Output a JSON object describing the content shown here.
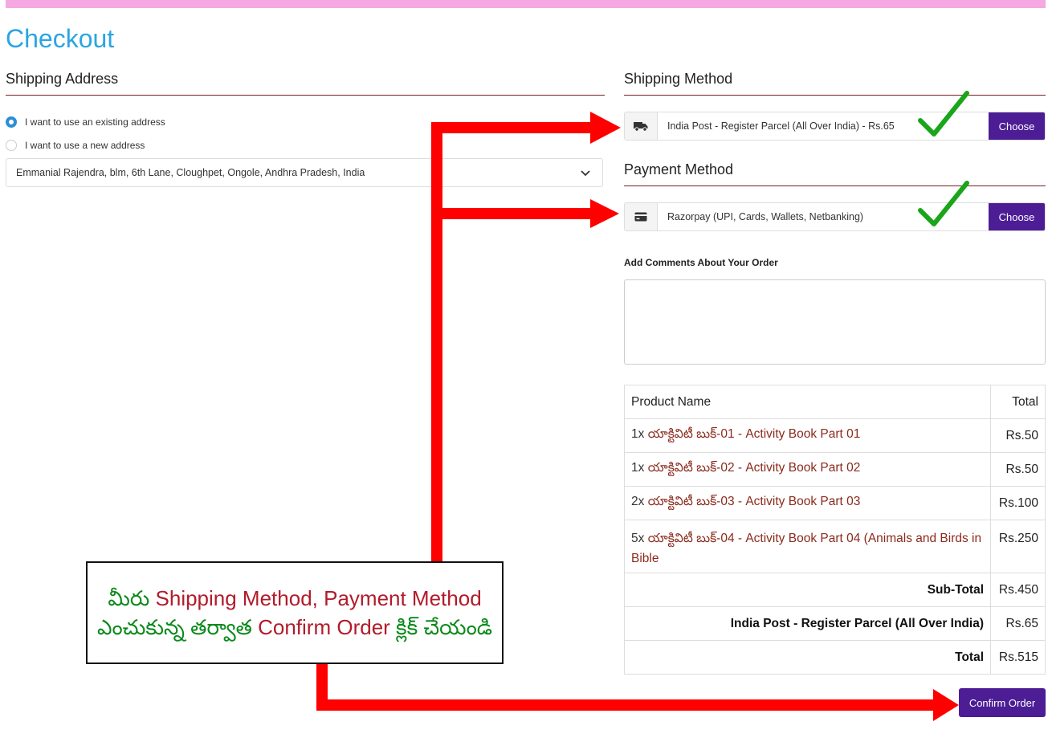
{
  "page": {
    "title": "Checkout"
  },
  "colors": {
    "accent": "#4c1d95",
    "title": "#2ba5e2",
    "annotation_arrow": "#ff0000",
    "check": "#1aa51a",
    "topbar": "#f6a8e2"
  },
  "shipping_address": {
    "title": "Shipping Address",
    "options": [
      {
        "label": "I want to use an existing address",
        "checked": true
      },
      {
        "label": "I want to use a new address",
        "checked": false
      }
    ],
    "selected_address": "Emmanial Rajendra, blm, 6th Lane, Cloughpet, Ongole, Andhra Pradesh, India"
  },
  "shipping_method": {
    "title": "Shipping Method",
    "icon": "truck-icon",
    "value": "India Post - Register Parcel (All Over India) - Rs.65",
    "button": "Choose"
  },
  "payment_method": {
    "title": "Payment Method",
    "icon": "credit-card-icon",
    "value": "Razorpay (UPI, Cards, Wallets, Netbanking)",
    "button": "Choose"
  },
  "comments": {
    "label": "Add Comments About Your Order"
  },
  "order": {
    "headers": {
      "product": "Product Name",
      "total": "Total"
    },
    "items": [
      {
        "qty": "1x",
        "name": "యాక్టివిటీ బుక్-01 - Activity Book Part 01",
        "total": "Rs.50"
      },
      {
        "qty": "1x",
        "name": "యాక్టివిటీ బుక్-02 - Activity Book Part 02",
        "total": "Rs.50"
      },
      {
        "qty": "2x",
        "name": "యాక్టివిటీ బుక్-03 - Activity Book Part 03",
        "total": "Rs.100"
      },
      {
        "qty": "5x",
        "name": "యాక్టివిటీ బుక్-04 - Activity Book Part 04 (Animals and Birds in Bible",
        "total": "Rs.250"
      }
    ],
    "subtotal": {
      "label": "Sub-Total",
      "value": "Rs.450"
    },
    "shipping": {
      "label": "India Post - Register Parcel (All Over India)",
      "value": "Rs.65"
    },
    "total": {
      "label": "Total",
      "value": "Rs.515"
    }
  },
  "confirm_button": "Confirm Order",
  "annotation": {
    "line1_te": "మీరు",
    "line1_en": "Shipping Method, Payment Method",
    "line2_te1": "ఎంచుకున్న తర్వాత",
    "line2_en": "Confirm Order",
    "line2_te2": "క్లిక్ చేయండి"
  }
}
